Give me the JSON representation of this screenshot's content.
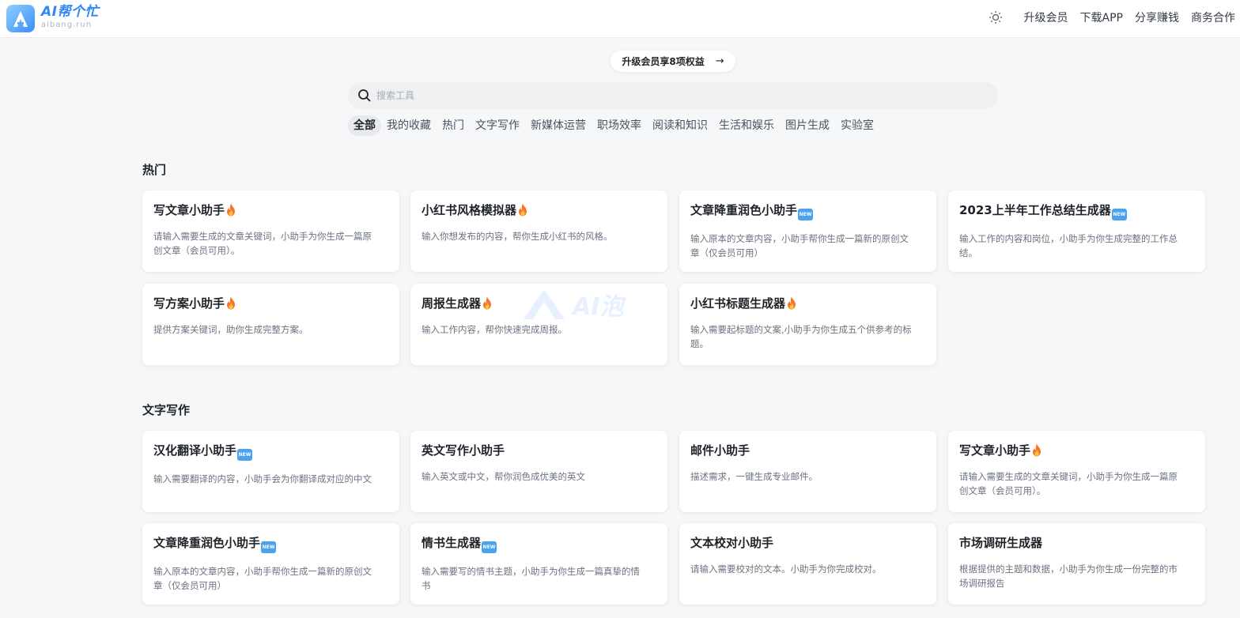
{
  "header": {
    "logo_title": "AI帮个忙",
    "logo_subtitle": "aibang.run",
    "nav": [
      "升级会员",
      "下载APP",
      "分享赚钱",
      "商务合作"
    ]
  },
  "promo": {
    "label": "升级会员享8项权益",
    "arrow": "→"
  },
  "search": {
    "placeholder": "搜索工具",
    "value": ""
  },
  "tabs": [
    "全部",
    "我的收藏",
    "热门",
    "文字写作",
    "新媒体运营",
    "职场效率",
    "阅读和知识",
    "生活和娱乐",
    "图片生成",
    "实验室"
  ],
  "active_tab": "全部",
  "watermark_text": "AI泡",
  "sections": [
    {
      "title": "热门",
      "cards": [
        {
          "title": "写文章小助手",
          "badge": "fire",
          "desc": "请输入需要生成的文章关键词，小助手为你生成一篇原创文章（会员可用）。"
        },
        {
          "title": "小红书风格模拟器",
          "badge": "fire",
          "desc": "输入你想发布的内容，帮你生成小红书的风格。"
        },
        {
          "title": "文章降重润色小助手",
          "badge": "new",
          "desc": "输入原本的文章内容，小助手帮你生成一篇新的原创文章（仅会员可用）"
        },
        {
          "title": "2023上半年工作总结生成器",
          "badge": "new",
          "desc": "输入工作的内容和岗位，小助手为你生成完整的工作总结。"
        },
        {
          "title": "写方案小助手",
          "badge": "fire",
          "desc": "提供方案关键词，助你生成完整方案。"
        },
        {
          "title": "周报生成器",
          "badge": "fire",
          "desc": "输入工作内容，帮你快速完成周报。"
        },
        {
          "title": "小红书标题生成器",
          "badge": "fire",
          "desc": "输入需要起标题的文案,小助手为你生成五个供参考的标题。"
        }
      ]
    },
    {
      "title": "文字写作",
      "cards": [
        {
          "title": "汉化翻译小助手",
          "badge": "new",
          "desc": "输入需要翻译的内容，小助手会为你翻译成对应的中文"
        },
        {
          "title": "英文写作小助手",
          "badge": "",
          "desc": "输入英文或中文，帮你润色成优美的英文"
        },
        {
          "title": "邮件小助手",
          "badge": "",
          "desc": "描述需求，一键生成专业邮件。"
        },
        {
          "title": "写文章小助手",
          "badge": "fire",
          "desc": "请输入需要生成的文章关键词，小助手为你生成一篇原创文章（会员可用）。"
        },
        {
          "title": "文章降重润色小助手",
          "badge": "new",
          "desc": "输入原本的文章内容，小助手帮你生成一篇新的原创文章（仅会员可用）"
        },
        {
          "title": "情书生成器",
          "badge": "new",
          "desc": "输入需要写的情书主题，小助手为你生成一篇真挚的情书"
        },
        {
          "title": "文本校对小助手",
          "badge": "",
          "desc": "请输入需要校对的文本。小助手为你完成校对。"
        },
        {
          "title": "市场调研生成器",
          "badge": "",
          "desc": "根据提供的主题和数据，小助手为你生成一份完整的市场调研报告"
        }
      ]
    }
  ],
  "colors": {
    "accent": "#2f86f6",
    "background": "#f6f7f9",
    "card": "#ffffff"
  },
  "icons": {
    "theme_toggle": "sun-icon",
    "search": "search-icon",
    "fire": "fire-emoji",
    "new": "new-emoji"
  }
}
